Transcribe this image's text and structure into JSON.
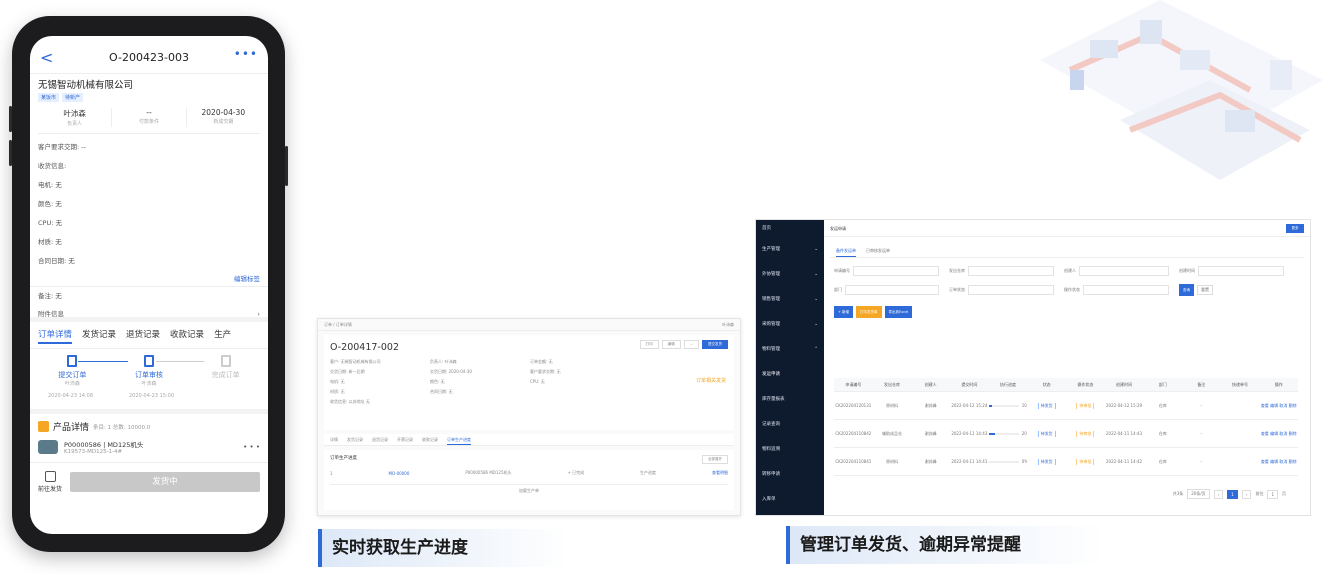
{
  "phone": {
    "title": "O-200423-003",
    "back": "<",
    "more": "•••",
    "company": "无锡智动机械有限公司",
    "tags": [
      "某饭市",
      "待新产"
    ],
    "summary": [
      {
        "value": "叶沛森",
        "label": "负责人"
      },
      {
        "value": "--",
        "label": "付款条件"
      },
      {
        "value": "2020-04-30",
        "label": "新成交期"
      }
    ],
    "fields": [
      "客户要求交期: --",
      "收货信息:",
      "电机: 无",
      "颜色: 无",
      "CPU: 无",
      "材质: 无",
      "合同日期: 无"
    ],
    "edit_label": "编辑标签",
    "note": "备注: 无",
    "attachments": "附件信息",
    "tabs": [
      "订单详情",
      "发货记录",
      "退货记录",
      "收款记录",
      "生产"
    ],
    "steps": [
      {
        "label": "提交订单",
        "person": "叶沛森",
        "date": "2020-04-23 14:08"
      },
      {
        "label": "订单审核",
        "person": "叶沛森",
        "date": "2020-04-23 15:00"
      },
      {
        "label": "完成订单",
        "person": "",
        "date": ""
      }
    ],
    "product_title": "产品详情",
    "product_stats": "条目: 1  总数: 10000.0",
    "product_name": "P00000586 | MD125机头",
    "product_code": "K19573-MD125-1-4#",
    "product_more": "• • •",
    "bottom_icon_label": "前往发货",
    "ship_button": "发货中"
  },
  "middle": {
    "crumb": "订单 / 订单详情",
    "crumb_right": "叶沛森",
    "title": "O-200417-002",
    "buttons": [
      "打印",
      "编辑",
      "...",
      "提交发货"
    ],
    "fields": [
      "客户: 无锡智动机械有限公司",
      "负责人: 叶沛森",
      "订单金额: 无",
      "交货日期: 新一后期",
      "交货日期: 2020-04-30",
      "客户要求交期: 无",
      "电机: 无",
      "颜色: 无",
      "CPU: 无",
      "材质: 无",
      "合同日期: 无",
      "",
      "收货信息: 以苏地址 无"
    ],
    "alert": "订单相关发货",
    "tabs": [
      "详情",
      "发货记录",
      "退货记录",
      "开票记录",
      "收款记录",
      "订单生产进度"
    ],
    "section_title": "订单生产进度",
    "section_btn": "全部展开",
    "row": [
      "1",
      "MO-00000",
      "P00000586 MD125机头",
      "+ 已完成",
      "生产进度",
      "查看明细"
    ],
    "more": "加载生产单"
  },
  "captions": [
    "实时获取生产进度",
    "管理订单发货、逾期异常提醒"
  ],
  "right": {
    "side_header": "首页",
    "side_items": [
      "生产管理",
      "外协管理",
      "销售管理",
      "采购管理",
      "物料管理",
      "发运申请",
      "库存量报表",
      "记录查询",
      "物料追溯",
      "转移申请",
      "入库单"
    ],
    "page_title": "发运申请",
    "top_btn": "更多",
    "tabs": [
      "备件发运单",
      "已审核发运单"
    ],
    "filters": [
      "申请编号",
      "发出仓库",
      "创建人",
      "创建时间",
      "部门",
      "订单状态",
      "操作状态",
      ""
    ],
    "actions": [
      {
        "label": "+ 新增",
        "color": "#2f6ad9"
      },
      {
        "label": "打印发货单",
        "color": "#f5a623"
      },
      {
        "label": "导出到Excel",
        "color": "#2f6ad9"
      }
    ],
    "search": "查询",
    "reset": "重置",
    "headers": [
      "申请编号",
      "发出仓库",
      "创建人",
      "提交时间",
      "执行进度",
      "状态",
      "操作状态",
      "创建时间",
      "部门",
      "备注",
      "快递单号",
      "操作"
    ],
    "rows": [
      {
        "id": "CK202204120131",
        "wh": "原材料",
        "user": "谢苏峰",
        "time": "2022-04-12 15:24",
        "pct": 10,
        "pct_label": "10%",
        "st": "待发货",
        "op": "待审批",
        "ctime": "2022-04-12 15:29",
        "dept": "仓库",
        "note": "-",
        "exp": "",
        "ops": "查看 编辑 取消 删除"
      },
      {
        "id": "CK202204110842",
        "wh": "辅助成品仓",
        "user": "谢苏峰",
        "time": "2022-04-11 14:43",
        "pct": 20,
        "pct_label": "20%",
        "st": "待发货",
        "op": "待审批",
        "ctime": "2022-04-11 14:43",
        "dept": "仓库",
        "note": "-",
        "exp": "",
        "ops": "查看 编辑 取消 删除"
      },
      {
        "id": "CK202204110841",
        "wh": "原材料",
        "user": "谢苏峰",
        "time": "2022-04-11 14:41",
        "pct": 0,
        "pct_label": "0%",
        "st": "待发货",
        "op": "待审批",
        "ctime": "2022-04-11 14:42",
        "dept": "仓库",
        "note": "-",
        "exp": "",
        "ops": "查看 编辑 取消 删除"
      }
    ],
    "pagination": {
      "total": "共3条",
      "size": "20条/页",
      "current": "1",
      "goto": "前往",
      "page_input": "1",
      "page_suffix": "页"
    }
  }
}
